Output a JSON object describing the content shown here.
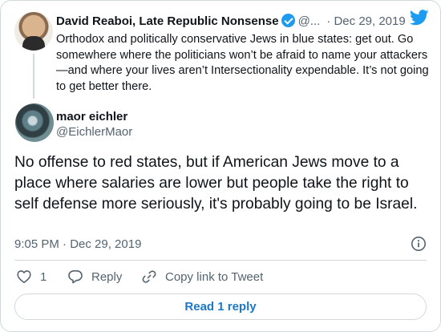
{
  "parent_tweet": {
    "author_name": "David Reaboi, Late Republic Nonsense",
    "author_handle": "@...",
    "date": "· Dec 29, 2019",
    "text": "Orthodox and politically conservative Jews in blue states: get out. Go somewhere where the politicians won’t be afraid to name your attackers—and where your lives aren’t Intersectionality expendable. It’s not going to get better there."
  },
  "reply_tweet": {
    "author_name": "maor eichler",
    "author_handle": "@EichlerMaor",
    "text": "No offense to red states, but if American Jews move to a place where salaries are lower but people take the right to self defense more seriously, it's probably going to be Israel.",
    "timestamp": "9:05 PM · Dec 29, 2019"
  },
  "actions": {
    "like_count": "1",
    "reply_label": "Reply",
    "copy_link_label": "Copy link to Tweet"
  },
  "read_replies_label": "Read 1 reply",
  "colors": {
    "twitter_blue": "#1d9bf0",
    "link_blue": "#1d77c4",
    "secondary_text": "#536471",
    "border": "#cfd9de"
  }
}
